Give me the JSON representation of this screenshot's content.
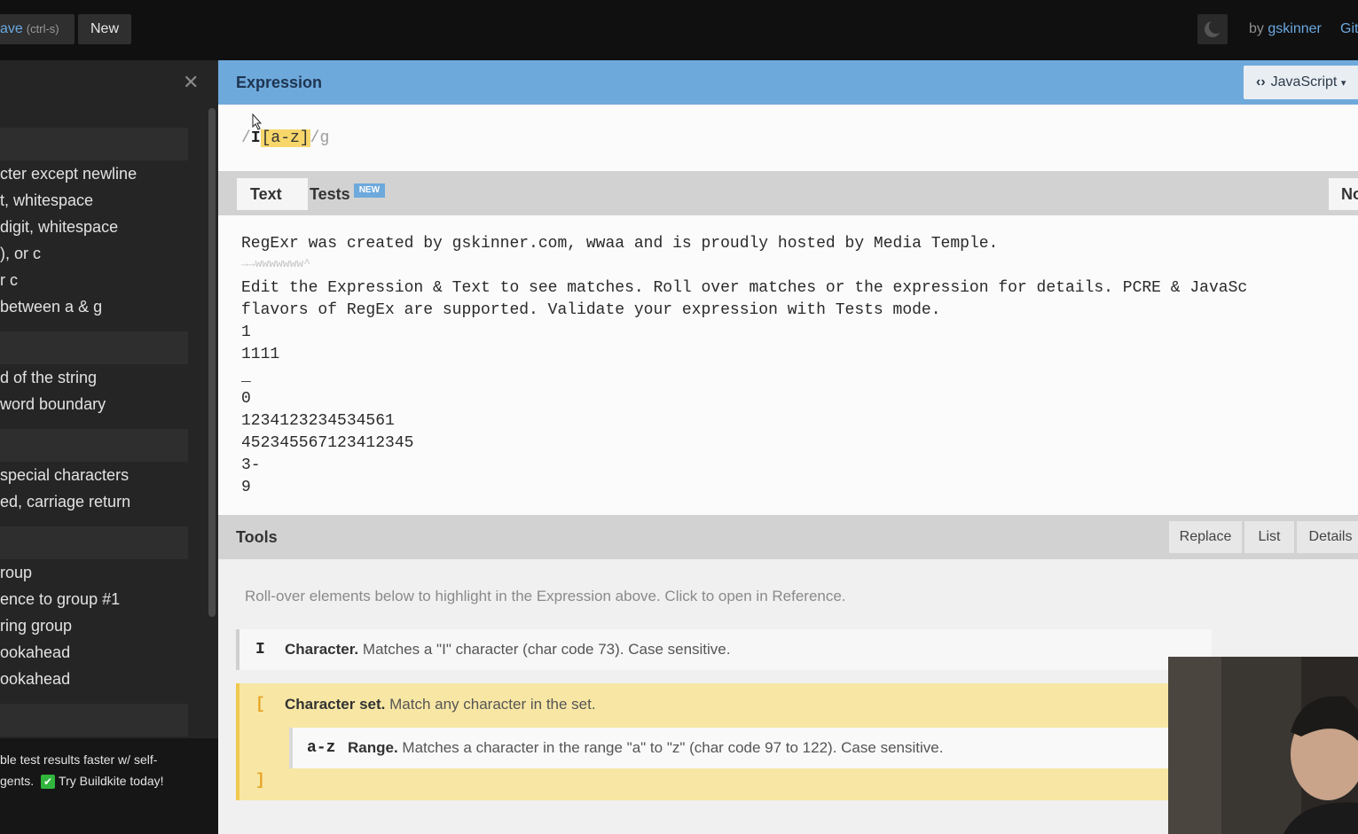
{
  "topbar": {
    "save_label": "ave",
    "save_hint": "(ctrl-s)",
    "new_label": "New",
    "by_label": "by",
    "author": "gskinner",
    "git_label": "Git"
  },
  "sidebar": {
    "items_group1": [
      "cter except newline",
      "t, whitespace",
      "digit, whitespace",
      "), or c",
      "r c",
      "between a & g"
    ],
    "items_group2": [
      "d of the string",
      "word boundary"
    ],
    "items_group3": [
      "special characters",
      "ed, carriage return"
    ],
    "items_group4": [
      "roup",
      "ence to group #1",
      "ring group",
      "ookahead",
      "ookahead"
    ],
    "ad_line1": "ble test results faster w/ self-",
    "ad_line2_pre": "gents.",
    "ad_line2_post": "Try Buildkite today!"
  },
  "expression": {
    "title": "Expression",
    "flavor": "JavaScript",
    "open_slash": "/",
    "literal": "I",
    "set": "[a-z]",
    "close": "/g"
  },
  "tabs": {
    "text": "Text",
    "tests": "Tests",
    "new_badge": "NEW",
    "right": "No"
  },
  "text_lines": [
    "RegExr was created by gskinner.com, wwaa and is proudly hosted by Media Temple.",
    "→→wwwwwww^",
    "Edit the Expression & Text to see matches. Roll over matches or the expression for details. PCRE & JavaSc",
    "flavors of RegEx are supported. Validate your expression with Tests mode.",
    "1",
    "1111",
    "",
    "_",
    "0",
    "1234123234534561",
    "452345567123412345",
    "3-",
    "9"
  ],
  "tools": {
    "title": "Tools",
    "replace": "Replace",
    "list": "List",
    "details": "Details",
    "hint": "Roll-over elements below to highlight in the Expression above. Click to open in Reference."
  },
  "explain": {
    "row1_glyph": "I",
    "row1_title": "Character.",
    "row1_desc": "Matches a \"I\" character (char code 73). Case sensitive.",
    "row2_open": "[",
    "row2_title": "Character set.",
    "row2_desc": "Match any character in the set.",
    "sub_glyph": "a-z",
    "sub_title": "Range.",
    "sub_desc": "Matches a character in the range \"a\" to \"z\" (char code 97 to 122). Case sensitive.",
    "row2_close": "]"
  },
  "colors": {
    "header_blue": "#6ea9dc",
    "set_highlight": "#f7d66a",
    "explain_highlight": "#f8e7a4"
  }
}
